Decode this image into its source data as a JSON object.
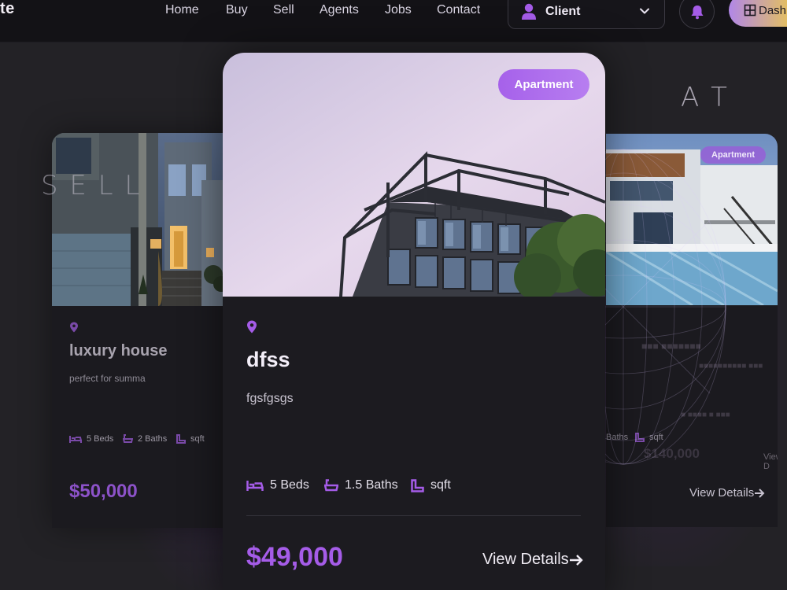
{
  "brand": {
    "logo_text": "te"
  },
  "nav": {
    "links": [
      "Home",
      "Buy",
      "Sell",
      "Agents",
      "Jobs",
      "Contact"
    ],
    "role_selected": "Client",
    "dashboard_label": "Dashb"
  },
  "decor": {
    "letters_left": "S E L L",
    "letters_right": "A T"
  },
  "cards": {
    "left": {
      "title": "luxury house",
      "description": "perfect for summa",
      "beds": "5 Beds",
      "baths": "2 Baths",
      "area": "sqft",
      "price": "$50,000"
    },
    "center": {
      "type": "Apartment",
      "title": "dfss",
      "description": "fgsfgsgs",
      "beds": "5 Beds",
      "baths": "1.5 Baths",
      "area": "sqft",
      "price": "$49,000",
      "view_label": "View Details"
    },
    "right": {
      "type": "Apartment",
      "baths": "Baths",
      "area": "sqft",
      "price": "$140,000",
      "view_label": "View Details",
      "view_label_faint": "View D"
    }
  },
  "colors": {
    "accent": "#a55ce8",
    "background": "#232226",
    "card": "#1c1b20",
    "nav": "#131216"
  }
}
